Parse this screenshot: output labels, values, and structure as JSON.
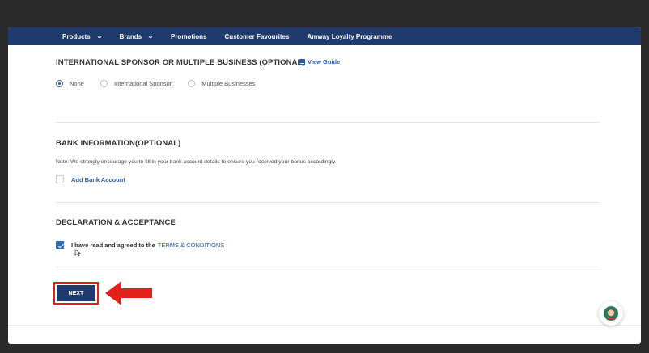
{
  "nav": {
    "items": [
      {
        "label": "Products",
        "has_dropdown": true
      },
      {
        "label": "Brands",
        "has_dropdown": true
      },
      {
        "label": "Promotions",
        "has_dropdown": false
      },
      {
        "label": "Customer Favourites",
        "has_dropdown": false
      },
      {
        "label": "Amway Loyalty Programme",
        "has_dropdown": false
      }
    ],
    "chevron": "⌄"
  },
  "sponsor_section": {
    "title": "INTERNATIONAL SPONSOR OR MULTIPLE BUSINESS (OPTIONAL)",
    "guide_label": "View Guide",
    "options": [
      {
        "label": "None",
        "selected": true
      },
      {
        "label": "International Sponsor",
        "selected": false
      },
      {
        "label": "Multiple Businesses",
        "selected": false
      }
    ]
  },
  "bank_section": {
    "title": "BANK INFORMATION(OPTIONAL)",
    "note": "Note: We strongly encourage you to fill in your bank account details to ensure you received your bonus accordingly.",
    "add_label": "Add Bank Account",
    "add_checked": false
  },
  "declaration_section": {
    "title": "DECLARATION & ACCEPTANCE",
    "agree_text": "I have read and agreed to the",
    "terms_link": "TERMS & CONDITIONS",
    "agree_checked": true
  },
  "actions": {
    "next_label": "NEXT"
  },
  "colors": {
    "nav_bg": "#1f3a6e",
    "link": "#2a5aa0",
    "highlight": "#e0201b"
  }
}
